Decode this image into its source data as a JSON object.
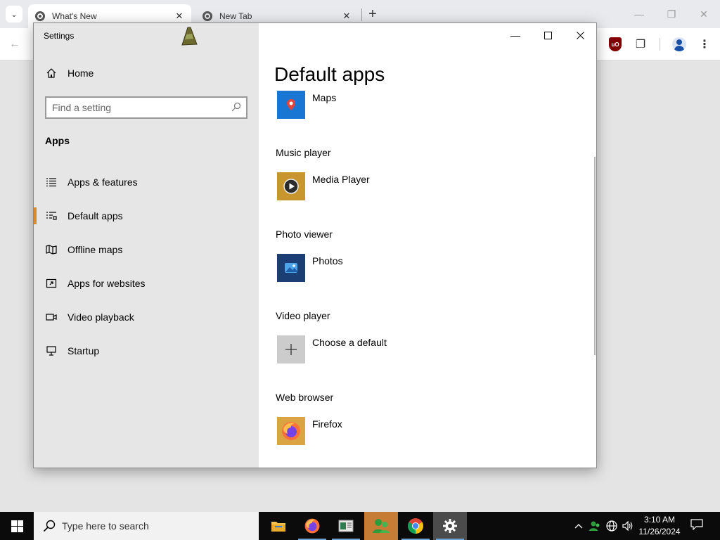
{
  "browser": {
    "tabs": [
      {
        "title": "What's New",
        "active": true
      },
      {
        "title": "New Tab",
        "active": false
      }
    ]
  },
  "window": {
    "title": "Settings"
  },
  "nav": {
    "home_label": "Home",
    "search_placeholder": "Find a setting",
    "section_title": "Apps",
    "items": [
      {
        "label": "Apps & features",
        "icon": "list-icon",
        "selected": false
      },
      {
        "label": "Default apps",
        "icon": "default-apps-icon",
        "selected": true
      },
      {
        "label": "Offline maps",
        "icon": "map-icon",
        "selected": false
      },
      {
        "label": "Apps for websites",
        "icon": "link-window-icon",
        "selected": false
      },
      {
        "label": "Video playback",
        "icon": "video-icon",
        "selected": false
      },
      {
        "label": "Startup",
        "icon": "startup-icon",
        "selected": false
      }
    ]
  },
  "content": {
    "page_title": "Default apps",
    "maps_app": "Maps",
    "sections": [
      {
        "category": "Music player",
        "app": "Media Player"
      },
      {
        "category": "Photo viewer",
        "app": "Photos"
      },
      {
        "category": "Video player",
        "app": "Choose a default"
      },
      {
        "category": "Web browser",
        "app": "Firefox"
      }
    ]
  },
  "taskbar": {
    "search_placeholder": "Type here to search",
    "clock_time": "3:10 AM",
    "clock_date": "11/26/2024"
  },
  "colors": {
    "accent": "#d98c2b",
    "maps_tile": "#1976d2",
    "media_tile": "#c8952f",
    "photos_tile": "#1b3e74",
    "default_tile": "#cccccc",
    "firefox_tile": "#d9a441"
  }
}
